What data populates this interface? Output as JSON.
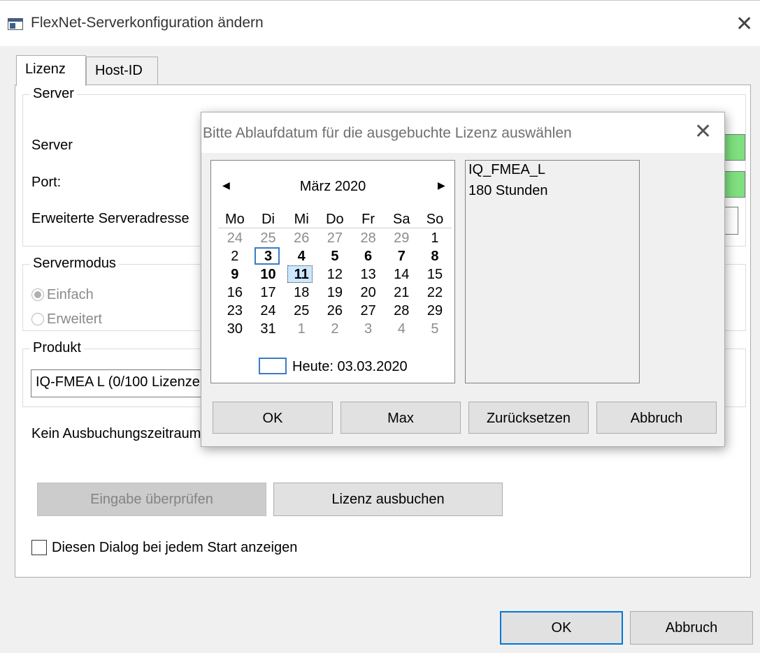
{
  "window": {
    "title": "FlexNet-Serverkonfiguration ändern",
    "close_glyph": "✕"
  },
  "tabs": [
    {
      "label": "Lizenz",
      "active": true
    },
    {
      "label": "Host-ID",
      "active": false
    }
  ],
  "server_group": {
    "legend": "Server",
    "server_label": "Server",
    "port_label": "Port:",
    "extended_label": "Erweiterte Serveradresse"
  },
  "servermode_group": {
    "legend": "Servermodus",
    "option_simple": "Einfach",
    "option_extended": "Erweitert",
    "selected": "Einfach"
  },
  "product_group": {
    "legend": "Produkt",
    "selected_value": "IQ-FMEA L (0/100 Lizenzen)"
  },
  "status_text": "Kein Ausbuchungszeitraum",
  "buttons": {
    "check_input": "Eingabe überprüfen",
    "checkout_license": "Lizenz ausbuchen",
    "ok": "OK",
    "cancel": "Abbruch"
  },
  "show_dialog_checkbox": {
    "label": "Diesen Dialog bei jedem Start anzeigen",
    "checked": false
  },
  "modal": {
    "title": "Bitte Ablaufdatum für die ausgebuchte Lizenz auswählen",
    "close_glyph": "✕",
    "calendar": {
      "month_label": "März 2020",
      "prev_glyph": "◀",
      "next_glyph": "▶",
      "weekdays": [
        "Mo",
        "Di",
        "Mi",
        "Do",
        "Fr",
        "Sa",
        "So"
      ],
      "weeks": [
        [
          "24",
          "25",
          "26",
          "27",
          "28",
          "29",
          "1"
        ],
        [
          "2",
          "3",
          "4",
          "5",
          "6",
          "7",
          "8"
        ],
        [
          "9",
          "10",
          "11",
          "12",
          "13",
          "14",
          "15"
        ],
        [
          "16",
          "17",
          "18",
          "19",
          "20",
          "21",
          "22"
        ],
        [
          "23",
          "24",
          "25",
          "26",
          "27",
          "28",
          "29"
        ],
        [
          "30",
          "31",
          "1",
          "2",
          "3",
          "4",
          "5"
        ]
      ],
      "today_label": "Heute: 03.03.2020",
      "today_day": "3",
      "selected_day": "11"
    },
    "info": {
      "product": "IQ_FMEA_L",
      "duration": "180 Stunden"
    },
    "buttons": {
      "ok": "OK",
      "max": "Max",
      "reset": "Zurücksetzen",
      "cancel": "Abbruch"
    }
  },
  "colors": {
    "accent": "#0078d7",
    "valid_field": "#7ee07e",
    "selected_day_bg": "#cce8ff",
    "today_border": "#3a7cc5"
  }
}
